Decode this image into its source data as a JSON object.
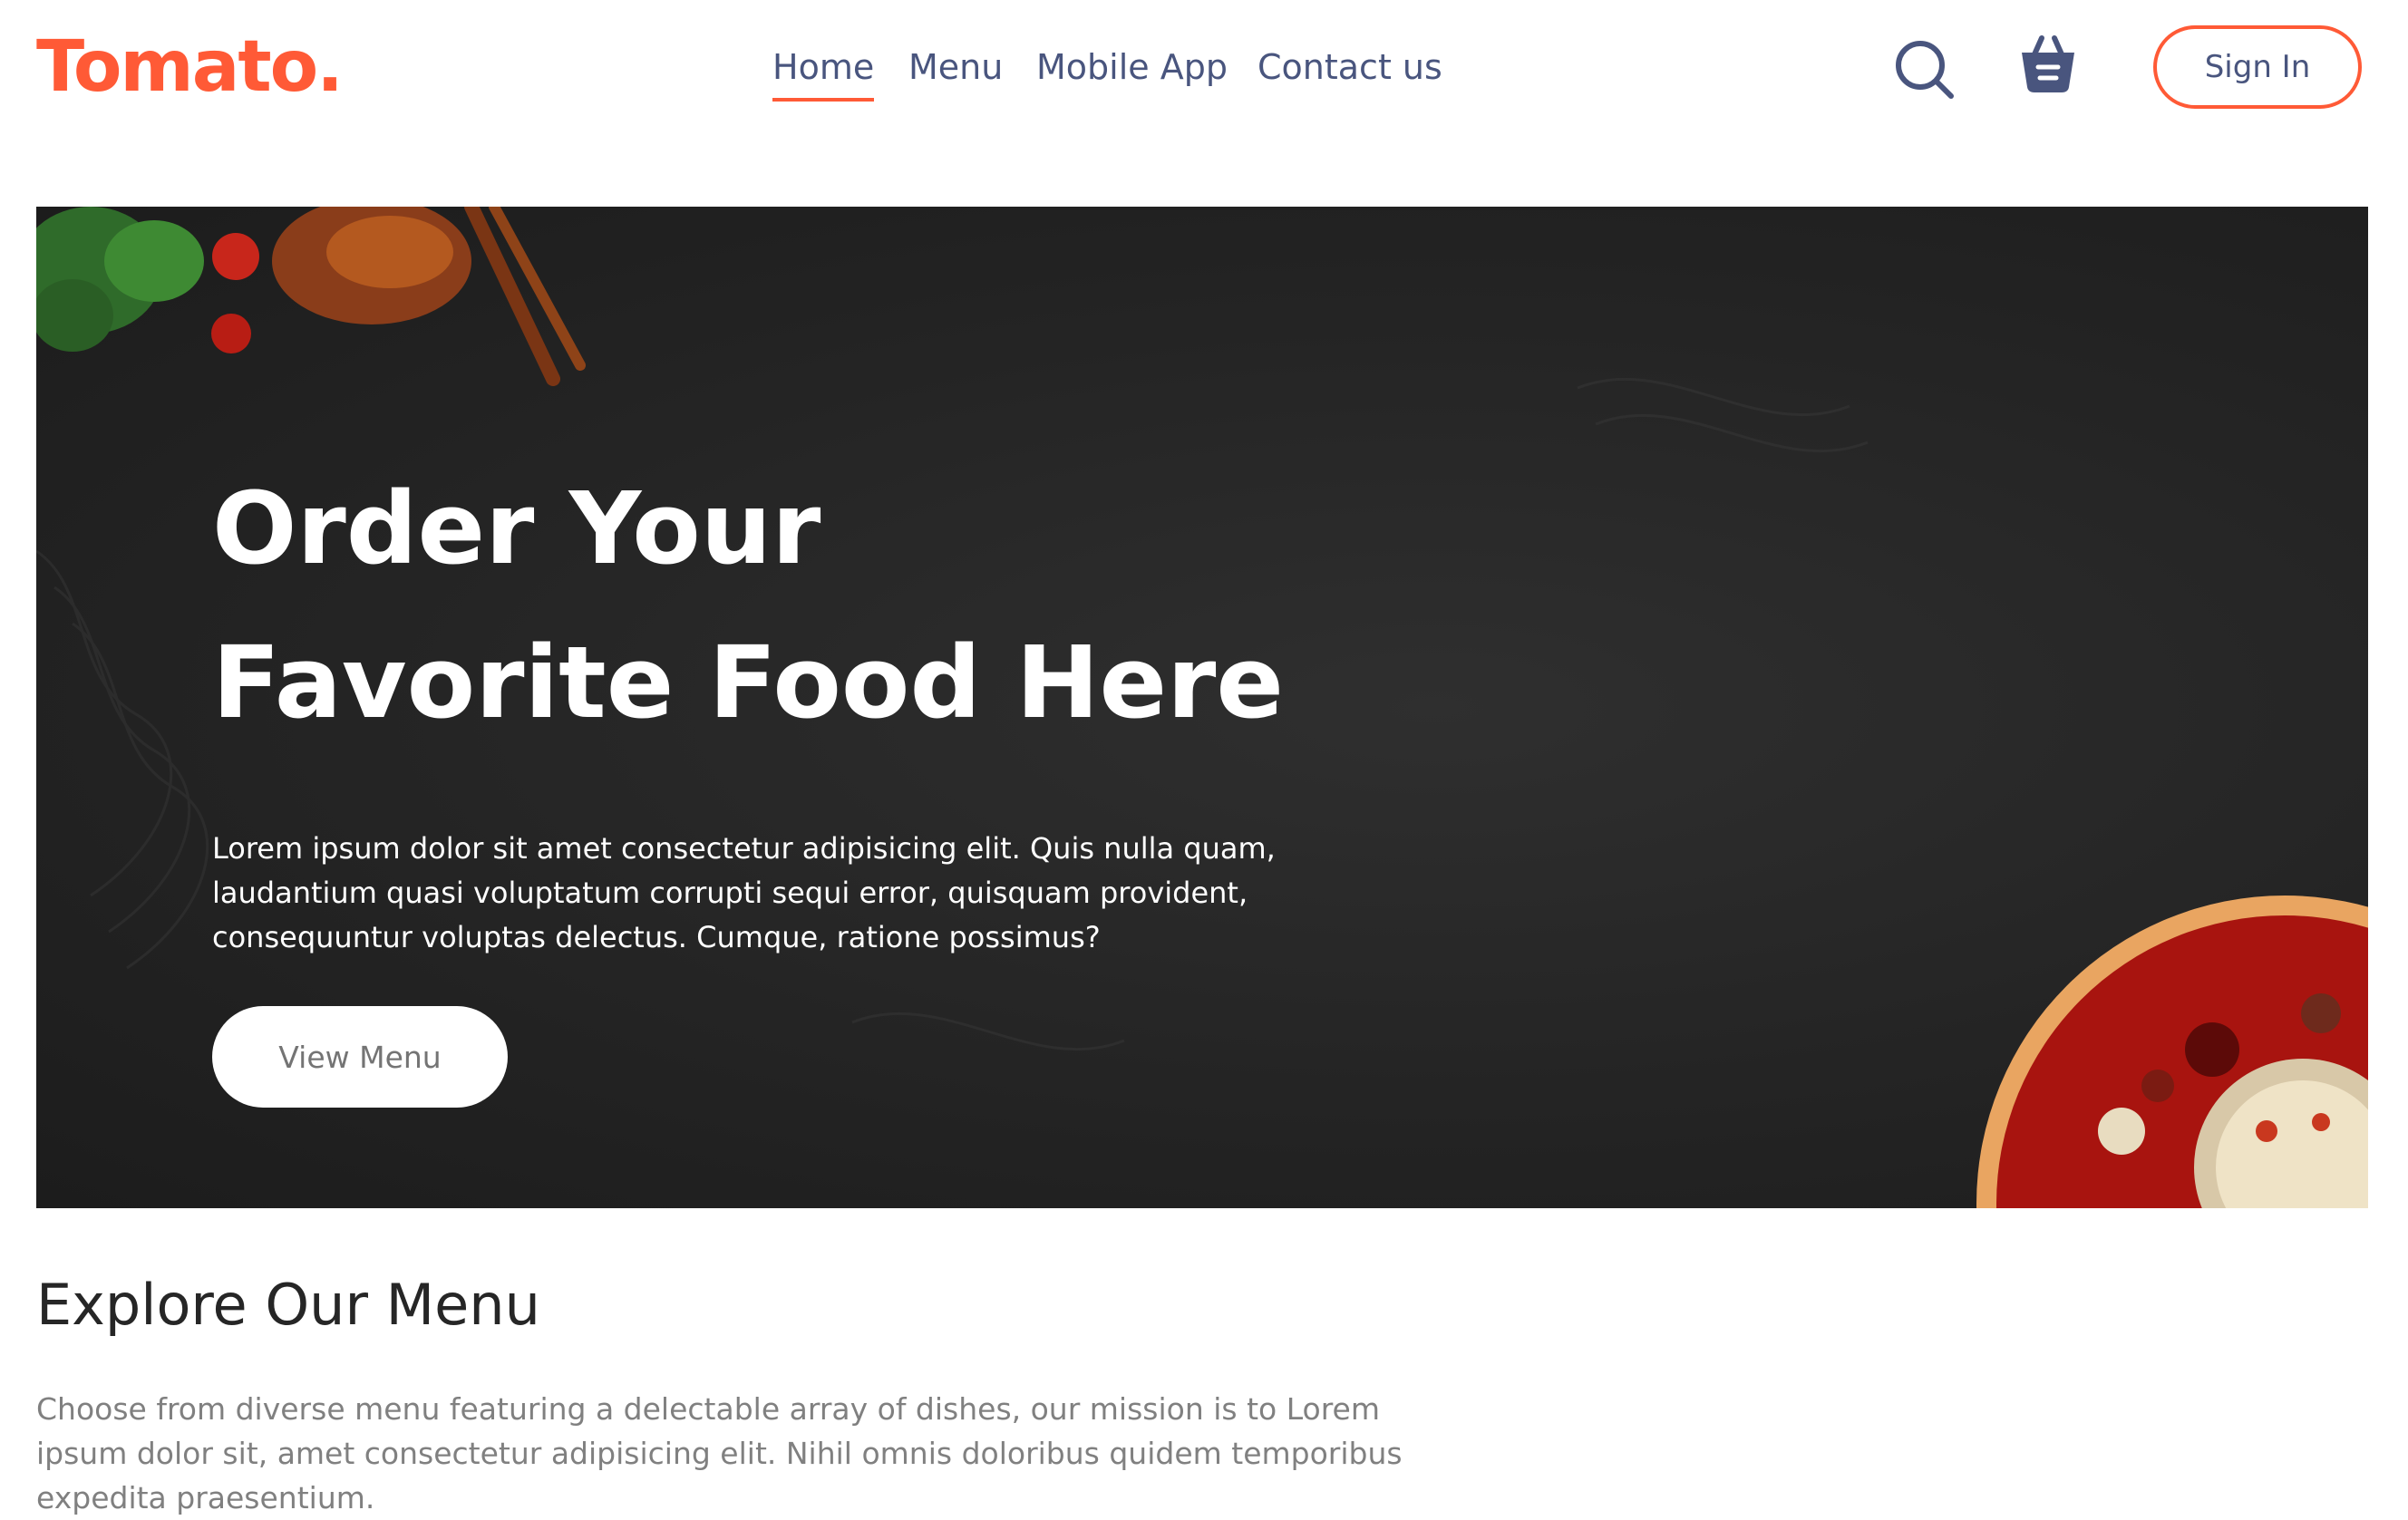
{
  "header": {
    "logo": "Tomato.",
    "nav": [
      "Home",
      "Menu",
      "Mobile App",
      "Contact us"
    ],
    "active_nav": "Home",
    "signin_label": "Sign In",
    "icons": [
      "search-icon",
      "basket-icon"
    ]
  },
  "hero": {
    "title_line1": "Order Your",
    "title_line2": "Favorite Food Here",
    "description": "Lorem ipsum dolor sit amet consectetur adipisicing elit. Quis nulla quam, laudantium quasi voluptatum corrupti sequi error, quisquam provident, consequuntur voluptas delectus. Cumque, ratione possimus?",
    "button_label": "View Menu"
  },
  "explore": {
    "title": "Explore Our Menu",
    "description": "Choose from diverse menu featuring a delectable array of dishes, our mission is to Lorem ipsum dolor sit, amet consectetur adipisicing elit. Nihil omnis doloribus quidem temporibus expedita praesentium."
  },
  "colors": {
    "brand": "#ff5a36",
    "nav_text": "#49557e",
    "hero_bg": "#262626",
    "muted_text": "#808080"
  }
}
